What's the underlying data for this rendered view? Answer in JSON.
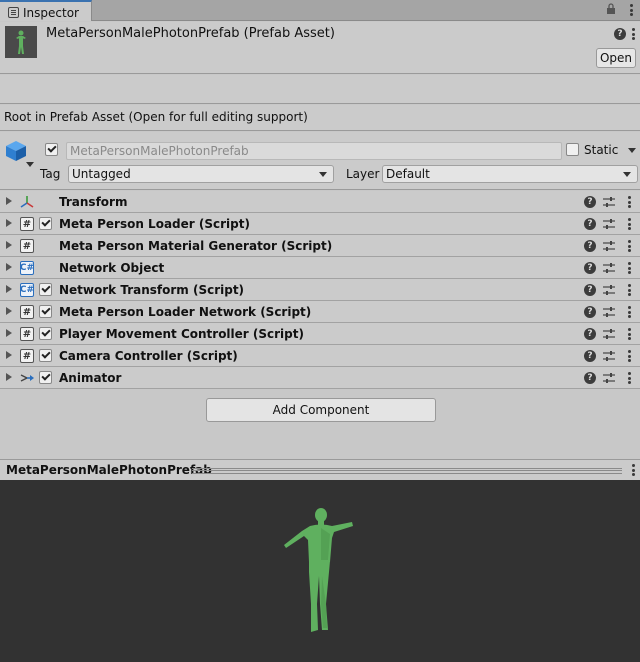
{
  "tab": {
    "title": "Inspector"
  },
  "header": {
    "asset_title": "MetaPersonMalePhotonPrefab (Prefab Asset)",
    "open_label": "Open",
    "help_glyph": "?"
  },
  "root_info": "Root in Prefab Asset (Open for full editing support)",
  "gameobject": {
    "name": "MetaPersonMalePhotonPrefab",
    "active": true,
    "static_label": "Static",
    "static": false,
    "tag_label": "Tag",
    "tag_value": "Untagged",
    "layer_label": "Layer",
    "layer_value": "Default"
  },
  "components": [
    {
      "name": "Transform",
      "icon": "transform-icon",
      "has_checkbox": false
    },
    {
      "name": "Meta Person Loader (Script)",
      "icon": "script-icon",
      "has_checkbox": true
    },
    {
      "name": "Meta Person Material Generator (Script)",
      "icon": "script-icon",
      "has_checkbox": false
    },
    {
      "name": "Network Object",
      "icon": "network-script-icon",
      "has_checkbox": false
    },
    {
      "name": "Network Transform (Script)",
      "icon": "network-script-icon",
      "has_checkbox": true
    },
    {
      "name": "Meta Person Loader Network (Script)",
      "icon": "script-icon",
      "has_checkbox": true
    },
    {
      "name": "Player Movement Controller (Script)",
      "icon": "script-icon",
      "has_checkbox": true
    },
    {
      "name": "Camera Controller (Script)",
      "icon": "script-icon",
      "has_checkbox": true
    },
    {
      "name": "Animator",
      "icon": "animator-icon",
      "has_checkbox": true
    }
  ],
  "add_component_label": "Add Component",
  "preview": {
    "title": "MetaPersonMalePhotonPrefab"
  },
  "colors": {
    "accent": "#3a72b0",
    "model": "#5fb05f",
    "preview_bg": "#323232"
  }
}
